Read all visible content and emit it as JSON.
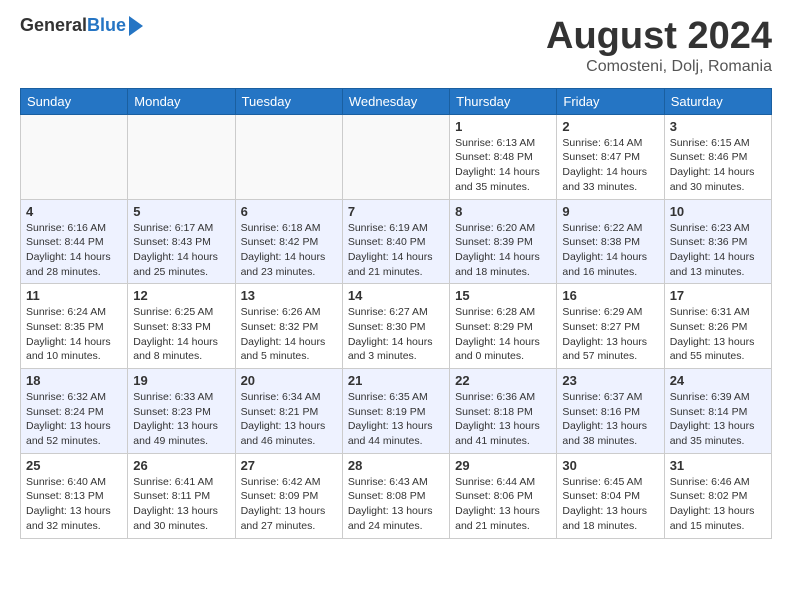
{
  "header": {
    "logo_general": "General",
    "logo_blue": "Blue",
    "main_title": "August 2024",
    "subtitle": "Comosteni, Dolj, Romania"
  },
  "calendar": {
    "days_of_week": [
      "Sunday",
      "Monday",
      "Tuesday",
      "Wednesday",
      "Thursday",
      "Friday",
      "Saturday"
    ],
    "weeks": [
      [
        {
          "day": "",
          "empty": true
        },
        {
          "day": "",
          "empty": true
        },
        {
          "day": "",
          "empty": true
        },
        {
          "day": "",
          "empty": true
        },
        {
          "day": "1",
          "sunrise": "6:13 AM",
          "sunset": "8:48 PM",
          "daylight": "14 hours and 35 minutes."
        },
        {
          "day": "2",
          "sunrise": "6:14 AM",
          "sunset": "8:47 PM",
          "daylight": "14 hours and 33 minutes."
        },
        {
          "day": "3",
          "sunrise": "6:15 AM",
          "sunset": "8:46 PM",
          "daylight": "14 hours and 30 minutes."
        }
      ],
      [
        {
          "day": "4",
          "sunrise": "6:16 AM",
          "sunset": "8:44 PM",
          "daylight": "14 hours and 28 minutes."
        },
        {
          "day": "5",
          "sunrise": "6:17 AM",
          "sunset": "8:43 PM",
          "daylight": "14 hours and 25 minutes."
        },
        {
          "day": "6",
          "sunrise": "6:18 AM",
          "sunset": "8:42 PM",
          "daylight": "14 hours and 23 minutes."
        },
        {
          "day": "7",
          "sunrise": "6:19 AM",
          "sunset": "8:40 PM",
          "daylight": "14 hours and 21 minutes."
        },
        {
          "day": "8",
          "sunrise": "6:20 AM",
          "sunset": "8:39 PM",
          "daylight": "14 hours and 18 minutes."
        },
        {
          "day": "9",
          "sunrise": "6:22 AM",
          "sunset": "8:38 PM",
          "daylight": "14 hours and 16 minutes."
        },
        {
          "day": "10",
          "sunrise": "6:23 AM",
          "sunset": "8:36 PM",
          "daylight": "14 hours and 13 minutes."
        }
      ],
      [
        {
          "day": "11",
          "sunrise": "6:24 AM",
          "sunset": "8:35 PM",
          "daylight": "14 hours and 10 minutes."
        },
        {
          "day": "12",
          "sunrise": "6:25 AM",
          "sunset": "8:33 PM",
          "daylight": "14 hours and 8 minutes."
        },
        {
          "day": "13",
          "sunrise": "6:26 AM",
          "sunset": "8:32 PM",
          "daylight": "14 hours and 5 minutes."
        },
        {
          "day": "14",
          "sunrise": "6:27 AM",
          "sunset": "8:30 PM",
          "daylight": "14 hours and 3 minutes."
        },
        {
          "day": "15",
          "sunrise": "6:28 AM",
          "sunset": "8:29 PM",
          "daylight": "14 hours and 0 minutes."
        },
        {
          "day": "16",
          "sunrise": "6:29 AM",
          "sunset": "8:27 PM",
          "daylight": "13 hours and 57 minutes."
        },
        {
          "day": "17",
          "sunrise": "6:31 AM",
          "sunset": "8:26 PM",
          "daylight": "13 hours and 55 minutes."
        }
      ],
      [
        {
          "day": "18",
          "sunrise": "6:32 AM",
          "sunset": "8:24 PM",
          "daylight": "13 hours and 52 minutes."
        },
        {
          "day": "19",
          "sunrise": "6:33 AM",
          "sunset": "8:23 PM",
          "daylight": "13 hours and 49 minutes."
        },
        {
          "day": "20",
          "sunrise": "6:34 AM",
          "sunset": "8:21 PM",
          "daylight": "13 hours and 46 minutes."
        },
        {
          "day": "21",
          "sunrise": "6:35 AM",
          "sunset": "8:19 PM",
          "daylight": "13 hours and 44 minutes."
        },
        {
          "day": "22",
          "sunrise": "6:36 AM",
          "sunset": "8:18 PM",
          "daylight": "13 hours and 41 minutes."
        },
        {
          "day": "23",
          "sunrise": "6:37 AM",
          "sunset": "8:16 PM",
          "daylight": "13 hours and 38 minutes."
        },
        {
          "day": "24",
          "sunrise": "6:39 AM",
          "sunset": "8:14 PM",
          "daylight": "13 hours and 35 minutes."
        }
      ],
      [
        {
          "day": "25",
          "sunrise": "6:40 AM",
          "sunset": "8:13 PM",
          "daylight": "13 hours and 32 minutes."
        },
        {
          "day": "26",
          "sunrise": "6:41 AM",
          "sunset": "8:11 PM",
          "daylight": "13 hours and 30 minutes."
        },
        {
          "day": "27",
          "sunrise": "6:42 AM",
          "sunset": "8:09 PM",
          "daylight": "13 hours and 27 minutes."
        },
        {
          "day": "28",
          "sunrise": "6:43 AM",
          "sunset": "8:08 PM",
          "daylight": "13 hours and 24 minutes."
        },
        {
          "day": "29",
          "sunrise": "6:44 AM",
          "sunset": "8:06 PM",
          "daylight": "13 hours and 21 minutes."
        },
        {
          "day": "30",
          "sunrise": "6:45 AM",
          "sunset": "8:04 PM",
          "daylight": "13 hours and 18 minutes."
        },
        {
          "day": "31",
          "sunrise": "6:46 AM",
          "sunset": "8:02 PM",
          "daylight": "13 hours and 15 minutes."
        }
      ]
    ]
  }
}
